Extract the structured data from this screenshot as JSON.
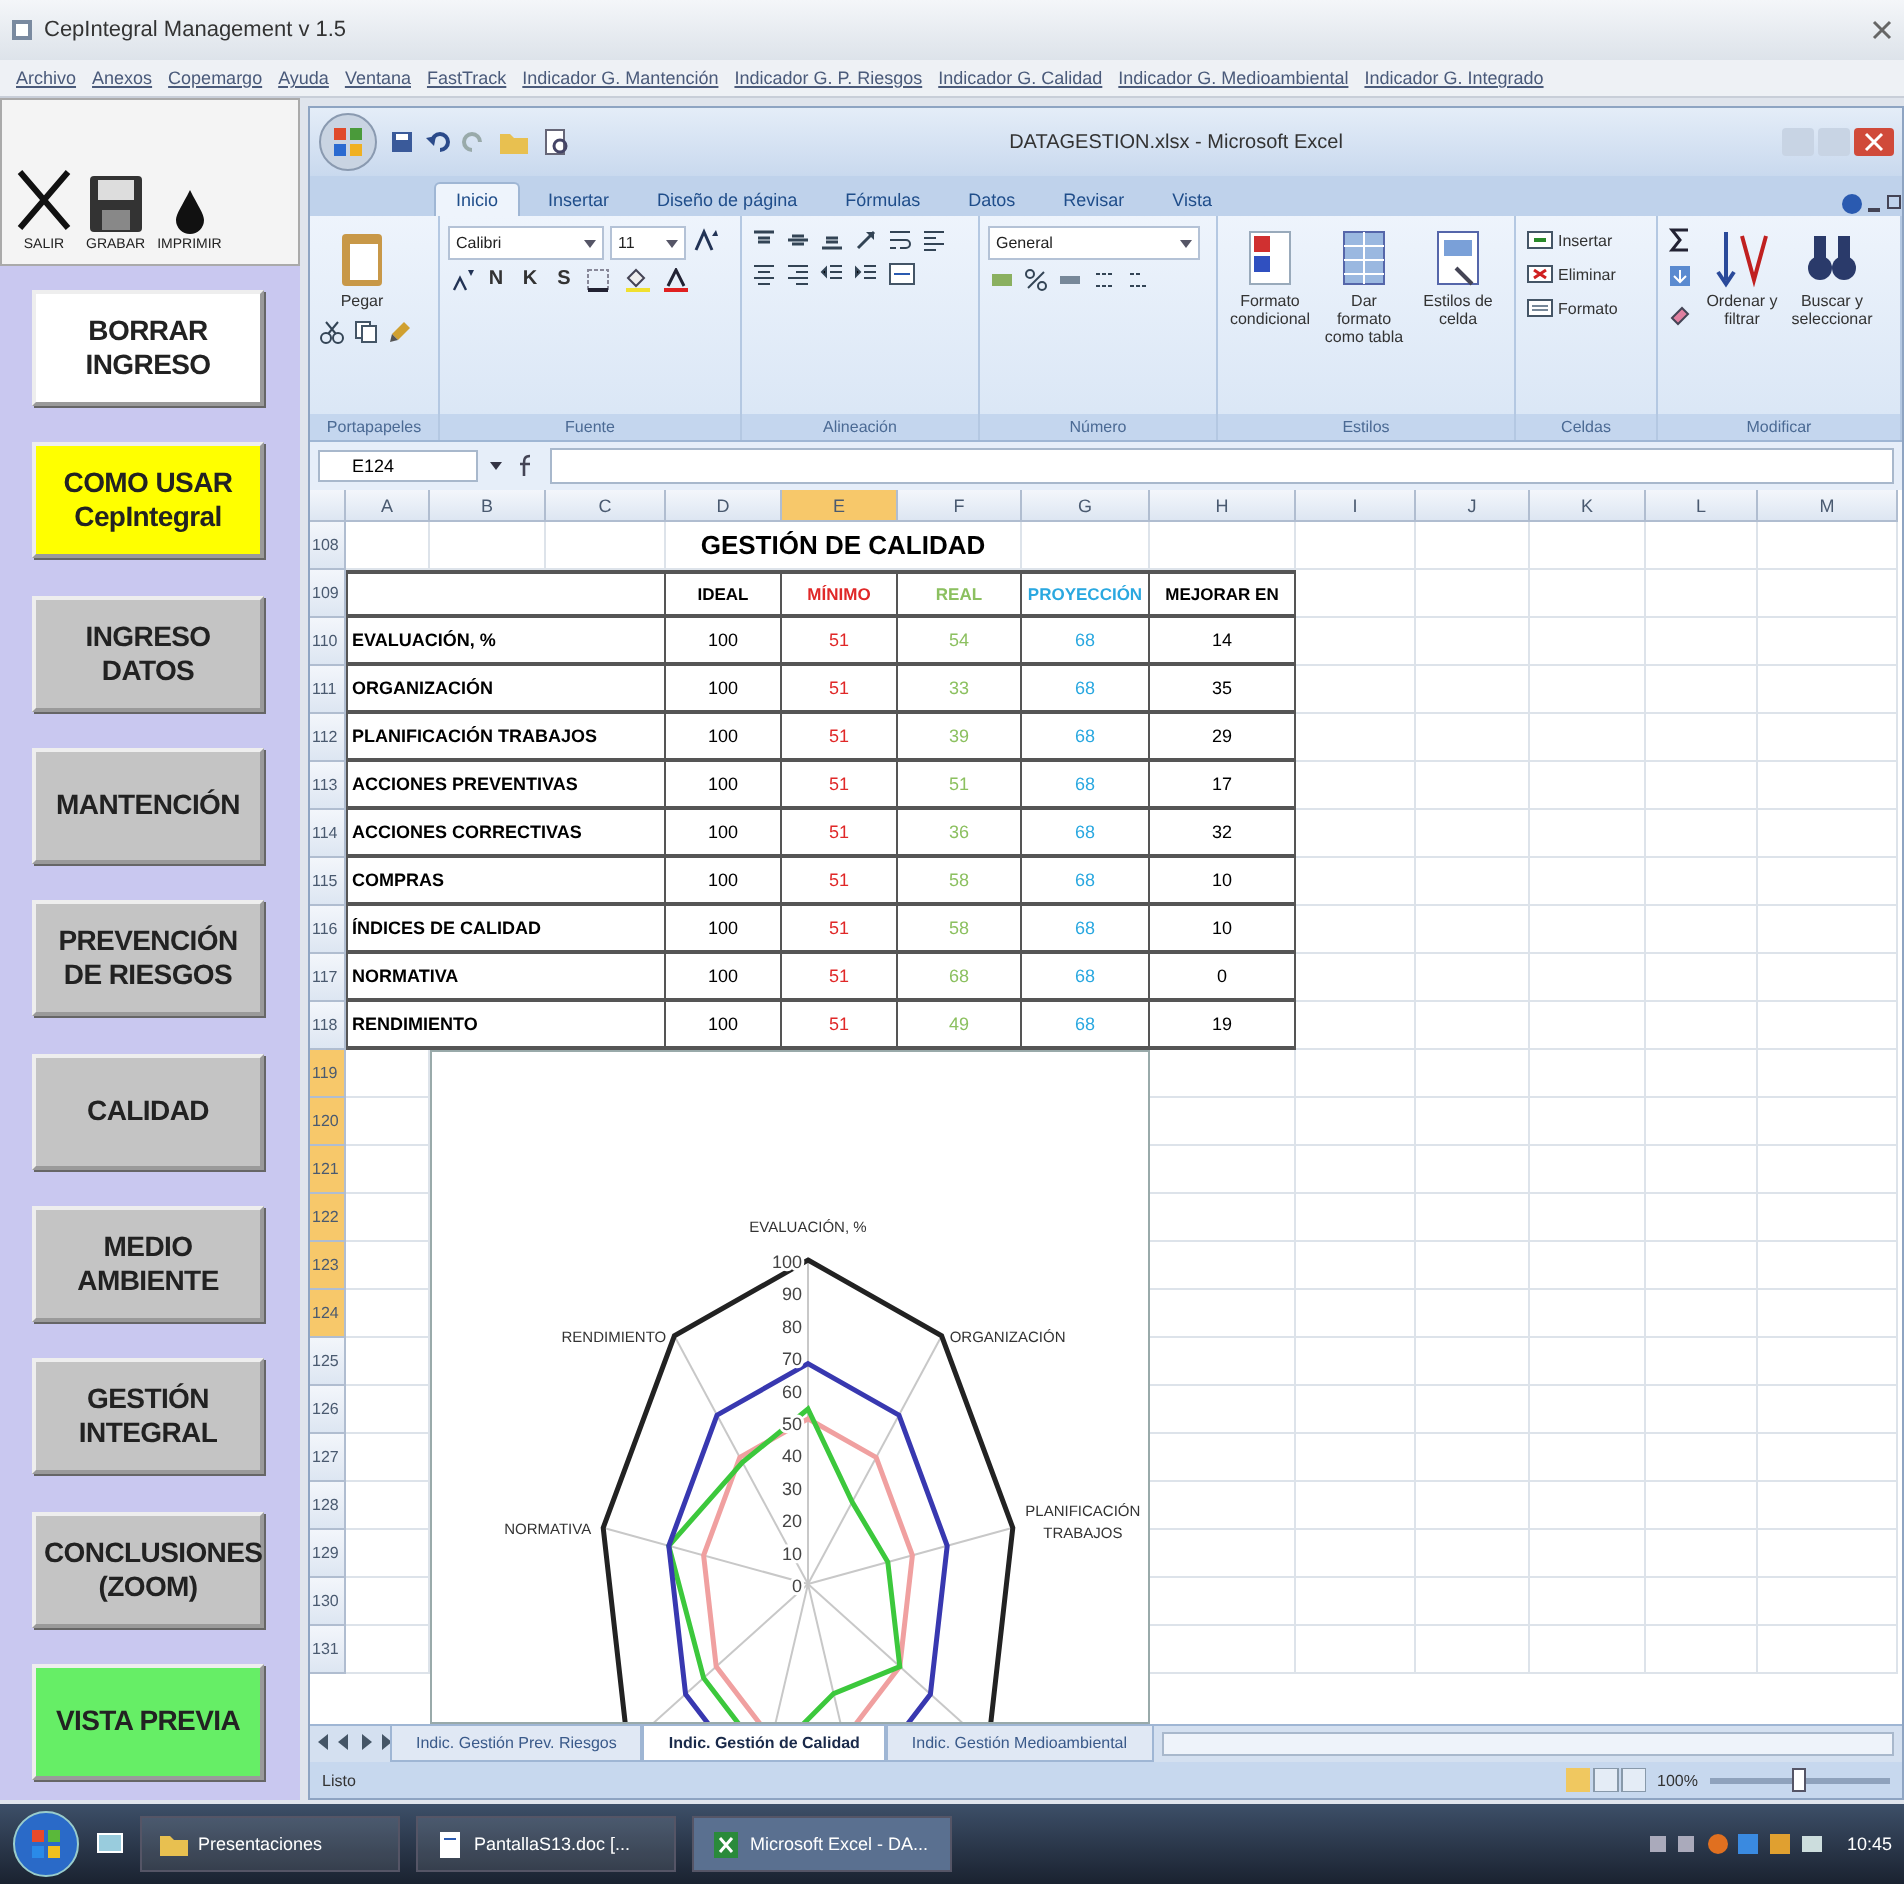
{
  "app": {
    "title": "CepIntegral Management v 1.5",
    "menu": [
      "Archivo",
      "Anexos",
      "Copemargo",
      "Ayuda",
      "Ventana",
      "FastTrack",
      "Indicador G. Mantención",
      "Indicador G. P. Riesgos",
      "Indicador G. Calidad",
      "Indicador G. Medioambiental",
      "Indicador G. Integrado"
    ]
  },
  "toolbar": [
    {
      "kind": "exit",
      "label": "SALIR"
    },
    {
      "kind": "save",
      "label": "GRABAR"
    },
    {
      "kind": "print",
      "label": "IMPRIMIR"
    }
  ],
  "nav_buttons": [
    {
      "label": "BORRAR INGRESO",
      "color": "#ffffff"
    },
    {
      "label": "COMO USAR CepIntegral",
      "color": "#ffff00"
    },
    {
      "label": "INGRESO DATOS",
      "color": "#c4c4c4"
    },
    {
      "label": "MANTENCIÓN",
      "color": "#c4c4c4"
    },
    {
      "label": "PREVENCIÓN DE RIESGOS",
      "color": "#c4c4c4"
    },
    {
      "label": "CALIDAD",
      "color": "#c4c4c4"
    },
    {
      "label": "MEDIO AMBIENTE",
      "color": "#c4c4c4"
    },
    {
      "label": "GESTIÓN INTEGRAL",
      "color": "#c4c4c4"
    },
    {
      "label": "CONCLUSIONES (ZOOM)",
      "color": "#c4c4c4"
    },
    {
      "label": "VISTA PREVIA",
      "color": "#66ee66"
    }
  ],
  "excel": {
    "title": "DATAGESTION.xlsx - Microsoft Excel",
    "tabs": [
      {
        "label": "Inicio",
        "selected": true
      },
      {
        "label": "Insertar",
        "selected": false
      },
      {
        "label": "Diseño de página",
        "selected": false
      },
      {
        "label": "Fórmulas",
        "selected": false
      },
      {
        "label": "Datos",
        "selected": false
      },
      {
        "label": "Revisar",
        "selected": false
      },
      {
        "label": "Vista",
        "selected": false
      }
    ],
    "ribbon": [
      {
        "label": "Portapapeles",
        "items": [
          {
            "kind": "paste",
            "label": "Pegar"
          },
          {
            "kind": "cut"
          },
          {
            "kind": "copy"
          },
          {
            "kind": "brush"
          }
        ]
      },
      {
        "label": "Fuente",
        "items": [
          {
            "kind": "field",
            "label": "Calibri"
          },
          {
            "kind": "field",
            "label": "11"
          },
          {
            "kind": "grow"
          },
          {
            "kind": "shrink"
          },
          {
            "kind": "letter",
            "label": "N"
          },
          {
            "kind": "letter",
            "label": "K"
          },
          {
            "kind": "letter",
            "label": "S"
          },
          {
            "kind": "border"
          },
          {
            "kind": "fill"
          },
          {
            "kind": "fontcolor"
          }
        ]
      },
      {
        "label": "Alineación",
        "items": [
          {
            "kind": "aligntop"
          },
          {
            "kind": "alignmid"
          },
          {
            "kind": "alignbot"
          },
          {
            "kind": "orient"
          },
          {
            "kind": "wrap"
          },
          {
            "kind": "alignleft"
          },
          {
            "kind": "aligncenter"
          },
          {
            "kind": "alignright"
          },
          {
            "kind": "outdent"
          },
          {
            "kind": "indent"
          },
          {
            "kind": "merge"
          }
        ]
      },
      {
        "label": "Número",
        "items": [
          {
            "kind": "field",
            "label": "General"
          },
          {
            "kind": "currency"
          },
          {
            "kind": "percent"
          },
          {
            "kind": "thousands"
          },
          {
            "kind": "incdec"
          },
          {
            "kind": "decdec"
          }
        ]
      },
      {
        "label": "Estilos",
        "items": [
          {
            "kind": "condformat",
            "label": "Formato condicional"
          },
          {
            "kind": "tableformat",
            "label": "Dar formato como tabla"
          },
          {
            "kind": "cellstyle",
            "label": "Estilos de celda"
          }
        ]
      },
      {
        "label": "Celdas",
        "items": [
          {
            "kind": "insert",
            "label": "Insertar"
          },
          {
            "kind": "delete",
            "label": "Eliminar"
          },
          {
            "kind": "format",
            "label": "Formato"
          }
        ]
      },
      {
        "label": "Modificar",
        "items": [
          {
            "kind": "sum"
          },
          {
            "kind": "filldown"
          },
          {
            "kind": "clear"
          },
          {
            "kind": "sort",
            "label": "Ordenar y filtrar"
          },
          {
            "kind": "find",
            "label": "Buscar y seleccionar"
          }
        ]
      }
    ],
    "name_box": "E124",
    "columns": [
      {
        "label": "A",
        "selected": false
      },
      {
        "label": "B",
        "selected": false
      },
      {
        "label": "C",
        "selected": false
      },
      {
        "label": "D",
        "selected": false
      },
      {
        "label": "E",
        "selected": true
      },
      {
        "label": "F",
        "selected": false
      },
      {
        "label": "G",
        "selected": false
      },
      {
        "label": "H",
        "selected": false
      },
      {
        "label": "I",
        "selected": false
      },
      {
        "label": "J",
        "selected": false
      },
      {
        "label": "K",
        "selected": false
      },
      {
        "label": "L",
        "selected": false
      },
      {
        "label": "M",
        "selected": false
      }
    ],
    "rows": [
      {
        "label": "108",
        "selected": false
      },
      {
        "label": "109",
        "selected": false
      },
      {
        "label": "110",
        "selected": false
      },
      {
        "label": "111",
        "selected": false
      },
      {
        "label": "112",
        "selected": false
      },
      {
        "label": "113",
        "selected": false
      },
      {
        "label": "114",
        "selected": false
      },
      {
        "label": "115",
        "selected": false
      },
      {
        "label": "116",
        "selected": false
      },
      {
        "label": "117",
        "selected": false
      },
      {
        "label": "118",
        "selected": false
      },
      {
        "label": "119",
        "selected": true
      },
      {
        "label": "120",
        "selected": true
      },
      {
        "label": "121",
        "selected": true
      },
      {
        "label": "122",
        "selected": true
      },
      {
        "label": "123",
        "selected": true
      },
      {
        "label": "124",
        "selected": true
      },
      {
        "label": "125",
        "selected": false
      },
      {
        "label": "126",
        "selected": false
      },
      {
        "label": "127",
        "selected": false
      },
      {
        "label": "128",
        "selected": false
      },
      {
        "label": "129",
        "selected": false
      },
      {
        "label": "130",
        "selected": false
      },
      {
        "label": "131",
        "selected": false
      }
    ],
    "table": {
      "title": "GESTIÓN DE CALIDAD",
      "columns": [
        {
          "label": "IDEAL",
          "color": "#000000"
        },
        {
          "label": "MÍNIMO",
          "color": "#e02828"
        },
        {
          "label": "REAL",
          "color": "#8cc060"
        },
        {
          "label": "PROYECCIÓN",
          "color": "#2aa8e0"
        },
        {
          "label": "MEJORAR EN",
          "color": "#000000"
        }
      ],
      "rows": [
        {
          "label": "EVALUACIÓN, %",
          "values": [
            "100",
            "51",
            "54",
            "68",
            "14"
          ]
        },
        {
          "label": "ORGANIZACIÓN",
          "values": [
            "100",
            "51",
            "33",
            "68",
            "35"
          ]
        },
        {
          "label": "PLANIFICACIÓN TRABAJOS",
          "values": [
            "100",
            "51",
            "39",
            "68",
            "29"
          ]
        },
        {
          "label": "ACCIONES PREVENTIVAS",
          "values": [
            "100",
            "51",
            "51",
            "68",
            "17"
          ]
        },
        {
          "label": "ACCIONES CORRECTIVAS",
          "values": [
            "100",
            "51",
            "36",
            "68",
            "32"
          ]
        },
        {
          "label": "COMPRAS",
          "values": [
            "100",
            "51",
            "58",
            "68",
            "10"
          ]
        },
        {
          "label": "ÍNDICES DE CALIDAD",
          "values": [
            "100",
            "51",
            "58",
            "68",
            "10"
          ]
        },
        {
          "label": "NORMATIVA",
          "values": [
            "100",
            "51",
            "68",
            "68",
            "0"
          ]
        },
        {
          "label": "RENDIMIENTO",
          "values": [
            "100",
            "51",
            "49",
            "68",
            "19"
          ]
        }
      ]
    },
    "radar": {
      "axis_labels": [
        {
          "label": "EVALUACIÓN, %",
          "kind": "top"
        },
        {
          "label": "RENDIMIENTO",
          "kind": "upperleft"
        },
        {
          "label": "ORGANIZACIÓN",
          "kind": "upperright"
        },
        {
          "label": "NORMATIVA",
          "kind": "left"
        },
        {
          "label": "PLANIFICACIÓN TRABAJOS",
          "kind": "right"
        }
      ],
      "ticks": [
        "100",
        "90",
        "80",
        "70",
        "60",
        "50",
        "40",
        "30",
        "20",
        "10",
        "0"
      ],
      "series": [
        {
          "color": "#222222"
        },
        {
          "color": "#f0a0a0"
        },
        {
          "color": "#3cc83c"
        },
        {
          "color": "#3838b0"
        }
      ]
    },
    "sheet_tabs": [
      {
        "label": "Indic. Gestión Prev. Riesgos",
        "selected": false
      },
      {
        "label": "Indic. Gestión de Calidad",
        "selected": true
      },
      {
        "label": "Indic. Gestión Medioambiental",
        "selected": false
      }
    ],
    "status": "Listo",
    "zoom": "100%",
    "zoom_slider": {
      "level": 0.5
    }
  },
  "taskbar": {
    "items": [
      {
        "label": "Presentaciones",
        "kind": "folder",
        "selected": false
      },
      {
        "label": "PantallaS13.doc [...",
        "kind": "document",
        "selected": false
      },
      {
        "label": "Microsoft Excel - DA...",
        "kind": "excel",
        "selected": true
      }
    ],
    "clock": "10:45"
  }
}
